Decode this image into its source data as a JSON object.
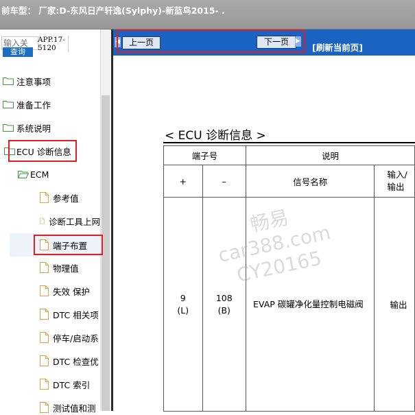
{
  "window": {
    "title": "前车型：  厂家:D-东风日产轩逸(Sylphy)-新蓝鸟2015-    ."
  },
  "sidebar": {
    "search_placeholder": "输入关",
    "search_button": "查询",
    "app_code": "APP.17-5120",
    "items": [
      {
        "label": "注意事项",
        "icon": "folder-icon"
      },
      {
        "label": "准备工作",
        "icon": "folder-icon"
      },
      {
        "label": "系统说明",
        "icon": "folder-icon"
      },
      {
        "label": "ECU 诊断信息",
        "icon": "folder-icon"
      },
      {
        "label": "ECM",
        "icon": "folder-open-icon"
      },
      {
        "label": "参考值",
        "icon": "document-icon"
      },
      {
        "label": "诊断工具上网",
        "icon": "document-icon"
      },
      {
        "label": "端子布置",
        "icon": "document-icon"
      },
      {
        "label": "物理值",
        "icon": "document-icon"
      },
      {
        "label": "失效 保护",
        "icon": "document-icon"
      },
      {
        "label": "DTC 相关项",
        "icon": "document-icon"
      },
      {
        "label": "停车/启动系",
        "icon": "document-icon"
      },
      {
        "label": "DTC 检查优",
        "icon": "document-icon"
      },
      {
        "label": "DTC 索引",
        "icon": "document-icon"
      },
      {
        "label": "测试值和测",
        "icon": "document-icon"
      }
    ]
  },
  "navbar": {
    "prev_label": "上一页",
    "next_label": "下一页",
    "refresh_label": "[刷新当前页]"
  },
  "document": {
    "heading": "< ECU 诊断信息 >",
    "table": {
      "header_terminal": "端子号",
      "header_description": "说明",
      "col_plus": "+",
      "col_minus": "–",
      "col_signal_name": "信号名称",
      "col_io": "输入/输出",
      "rows": [
        {
          "plus": "9",
          "plus_wire": "(L)",
          "minus": "108",
          "minus_wire": "(B)",
          "signal": "EVAP 碳罐净化量控制电磁阀",
          "io": "输出"
        }
      ]
    },
    "watermark": [
      "畅易",
      "car388.com",
      "CY20165"
    ]
  }
}
